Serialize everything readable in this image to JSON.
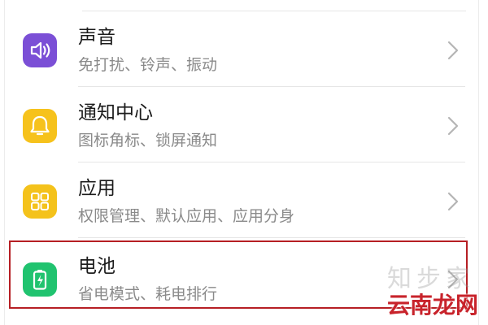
{
  "settings_list": {
    "items": [
      {
        "title": "声音",
        "subtitle": "免打扰、铃声、振动",
        "icon": "speaker-icon",
        "icon_color": "#7b4fd6"
      },
      {
        "title": "通知中心",
        "subtitle": "图标角标、锁屏通知",
        "icon": "bell-icon",
        "icon_color": "#f6c21c"
      },
      {
        "title": "应用",
        "subtitle": "权限管理、默认应用、应用分身",
        "icon": "apps-grid-icon",
        "icon_color": "#f4c21b"
      },
      {
        "title": "电池",
        "subtitle": "省电模式、耗电排行",
        "icon": "battery-icon",
        "icon_color": "#20c36f"
      }
    ]
  },
  "annotation": {
    "highlight_color": "#b61f24"
  },
  "watermark": {
    "site_text": "知步家",
    "brand_text": "云南龙网"
  }
}
